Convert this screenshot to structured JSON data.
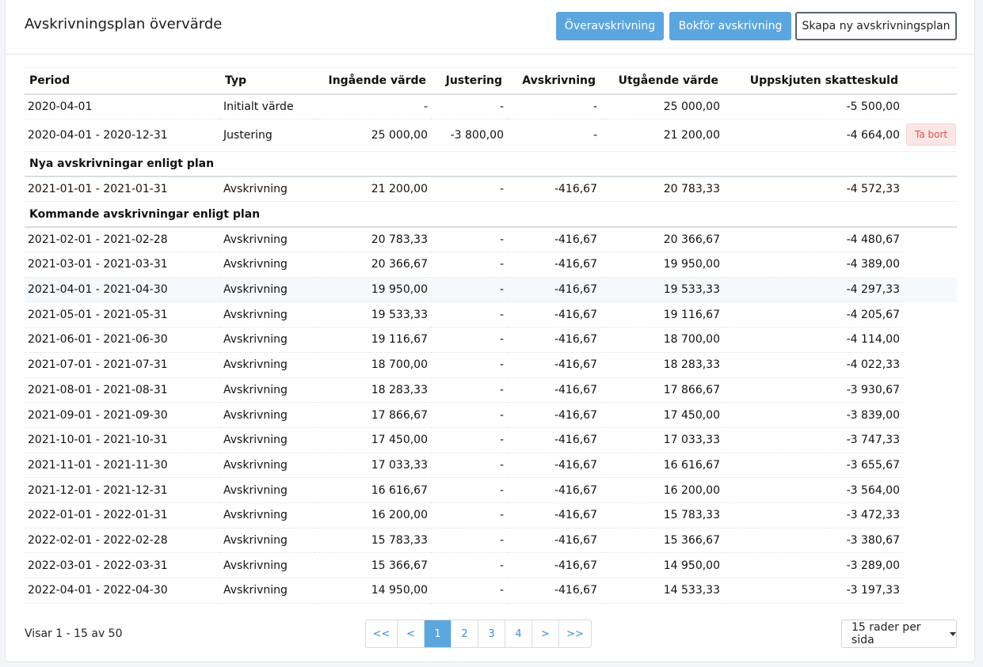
{
  "header": {
    "title": "Avskrivningsplan övervärde",
    "btn_over": "Överavskrivning",
    "btn_book": "Bokför avskrivning",
    "btn_new": "Skapa ny avskrivningsplan"
  },
  "table": {
    "columns": [
      "Period",
      "Typ",
      "Ingående värde",
      "Justering",
      "Avskrivning",
      "Utgående värde",
      "Uppskjuten skatteskuld"
    ],
    "rows_initial": [
      [
        "2020-04-01",
        "Initialt värde",
        "-",
        "-",
        "-",
        "25 000,00",
        "-5 500,00"
      ]
    ],
    "row_adjust": [
      "2020-04-01 - 2020-12-31",
      "Justering",
      "25 000,00",
      "-3 800,00",
      "-",
      "21 200,00",
      "-4 664,00"
    ],
    "delete_label": "Ta bort",
    "section_new": "Nya avskrivningar enligt plan",
    "rows_new": [
      [
        "2021-01-01 - 2021-01-31",
        "Avskrivning",
        "21 200,00",
        "-",
        "-416,67",
        "20 783,33",
        "-4 572,33"
      ]
    ],
    "section_upcoming": "Kommande avskrivningar enligt plan",
    "rows_upcoming": [
      [
        "2021-02-01 - 2021-02-28",
        "Avskrivning",
        "20 783,33",
        "-",
        "-416,67",
        "20 366,67",
        "-4 480,67"
      ],
      [
        "2021-03-01 - 2021-03-31",
        "Avskrivning",
        "20 366,67",
        "-",
        "-416,67",
        "19 950,00",
        "-4 389,00"
      ],
      [
        "2021-04-01 - 2021-04-30",
        "Avskrivning",
        "19 950,00",
        "-",
        "-416,67",
        "19 533,33",
        "-4 297,33"
      ],
      [
        "2021-05-01 - 2021-05-31",
        "Avskrivning",
        "19 533,33",
        "-",
        "-416,67",
        "19 116,67",
        "-4 205,67"
      ],
      [
        "2021-06-01 - 2021-06-30",
        "Avskrivning",
        "19 116,67",
        "-",
        "-416,67",
        "18 700,00",
        "-4 114,00"
      ],
      [
        "2021-07-01 - 2021-07-31",
        "Avskrivning",
        "18 700,00",
        "-",
        "-416,67",
        "18 283,33",
        "-4 022,33"
      ],
      [
        "2021-08-01 - 2021-08-31",
        "Avskrivning",
        "18 283,33",
        "-",
        "-416,67",
        "17 866,67",
        "-3 930,67"
      ],
      [
        "2021-09-01 - 2021-09-30",
        "Avskrivning",
        "17 866,67",
        "-",
        "-416,67",
        "17 450,00",
        "-3 839,00"
      ],
      [
        "2021-10-01 - 2021-10-31",
        "Avskrivning",
        "17 450,00",
        "-",
        "-416,67",
        "17 033,33",
        "-3 747,33"
      ],
      [
        "2021-11-01 - 2021-11-30",
        "Avskrivning",
        "17 033,33",
        "-",
        "-416,67",
        "16 616,67",
        "-3 655,67"
      ],
      [
        "2021-12-01 - 2021-12-31",
        "Avskrivning",
        "16 616,67",
        "-",
        "-416,67",
        "16 200,00",
        "-3 564,00"
      ],
      [
        "2022-01-01 - 2022-01-31",
        "Avskrivning",
        "16 200,00",
        "-",
        "-416,67",
        "15 783,33",
        "-3 472,33"
      ],
      [
        "2022-02-01 - 2022-02-28",
        "Avskrivning",
        "15 783,33",
        "-",
        "-416,67",
        "15 366,67",
        "-3 380,67"
      ],
      [
        "2022-03-01 - 2022-03-31",
        "Avskrivning",
        "15 366,67",
        "-",
        "-416,67",
        "14 950,00",
        "-3 289,00"
      ],
      [
        "2022-04-01 - 2022-04-30",
        "Avskrivning",
        "14 950,00",
        "-",
        "-416,67",
        "14 533,33",
        "-3 197,33"
      ]
    ]
  },
  "footer": {
    "showing": "Visar 1 - 15 av 50",
    "pages": [
      "<<",
      "<",
      "1",
      "2",
      "3",
      "4",
      ">",
      ">>"
    ],
    "active_page": "1",
    "rows_per_page": "15 rader per sida"
  }
}
